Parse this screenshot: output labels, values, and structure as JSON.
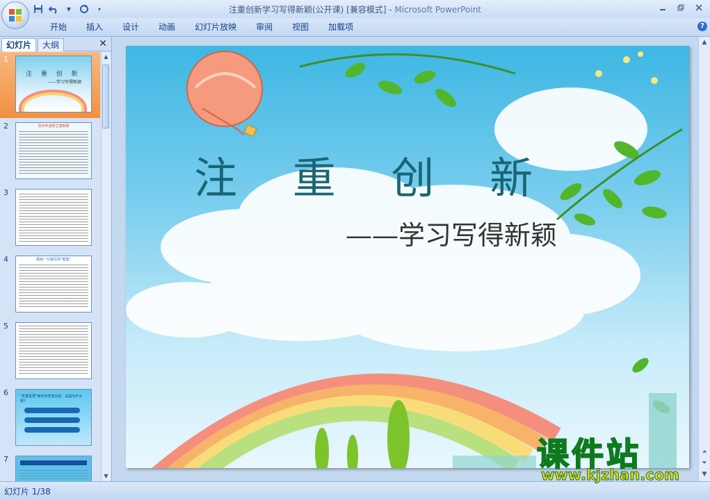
{
  "window": {
    "title": "注重创新学习写得新颖(公开课) [兼容模式]",
    "title_sep": " - ",
    "app_name": "Microsoft PowerPoint"
  },
  "quick_access": {
    "icons": [
      "save-icon",
      "undo-icon",
      "redo-icon",
      "customize-icon"
    ]
  },
  "ribbon": {
    "tabs": [
      "开始",
      "插入",
      "设计",
      "动画",
      "幻灯片放映",
      "审阅",
      "视图",
      "加载项"
    ]
  },
  "left_pane": {
    "tabs": [
      "幻灯片",
      "大纲"
    ],
    "active_tab": "幻灯片",
    "thumbnails": [
      {
        "number": "1",
        "selected": true,
        "title": "注 重 创 新",
        "subtitle": "——学习写得新颖"
      },
      {
        "number": "2",
        "selected": false,
        "heading": "写作中怎样立意新颖"
      },
      {
        "number": "3",
        "selected": false
      },
      {
        "number": "4",
        "selected": false,
        "heading": "题目一只能写的\"老鼠\""
      },
      {
        "number": "5",
        "selected": false
      },
      {
        "number": "6",
        "selected": false,
        "heading": "\"天皇星君\"每日天空有云彩，这是为什么呢？"
      },
      {
        "number": "7",
        "selected": false
      }
    ]
  },
  "slide": {
    "title": "注 重 创 新",
    "subtitle": "——学习写得新颖"
  },
  "watermark": {
    "text": "课件站",
    "url": "www.kjzhan.com"
  },
  "status_bar": {
    "slide_position": "幻灯片 1/38"
  },
  "colors": {
    "ribbon_text": "#15428b",
    "selected_thumb": "#f29040",
    "slide_title": "#1a6575",
    "watermark_fill": "#f5d21a",
    "watermark_stroke": "#0d7a1f"
  }
}
